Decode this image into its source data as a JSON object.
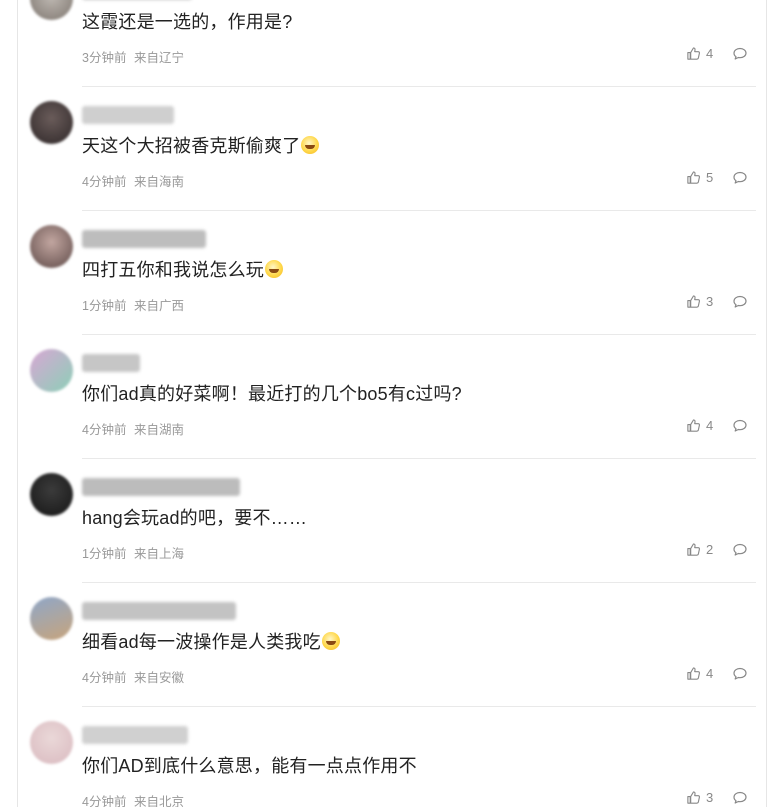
{
  "comments": [
    {
      "text": "这霞还是一选的，作用是?",
      "time": "3分钟前",
      "location": "来自辽宁",
      "likes": "4",
      "emoji": false,
      "avatar_colors": [
        "#bfb9b3",
        "#7d756e"
      ],
      "name_color": "#c9c9c9"
    },
    {
      "text": "天这个大招被香克斯偷爽了",
      "time": "4分钟前",
      "location": "来自海南",
      "likes": "5",
      "emoji": true,
      "avatar_colors": [
        "#6a5c5a",
        "#2e2728"
      ],
      "name_color": "#cfcfcf"
    },
    {
      "text": "四打五你和我说怎么玩",
      "time": "1分钟前",
      "location": "来自广西",
      "likes": "3",
      "emoji": true,
      "avatar_colors": [
        "#c2a6a0",
        "#5e4a48"
      ],
      "name_color": "#bdbdbd"
    },
    {
      "text": "你们ad真的好菜啊！最近打的几个bo5有c过吗?",
      "time": "4分钟前",
      "location": "来自湖南",
      "likes": "4",
      "emoji": false,
      "avatar_colors": [
        "#d8a7d4",
        "#8ccfb7"
      ],
      "name_color": "#c6c6c6"
    },
    {
      "text": "hang会玩ad的吧，要不……",
      "time": "1分钟前",
      "location": "来自上海",
      "likes": "2",
      "emoji": false,
      "avatar_colors": [
        "#3b3b3b",
        "#151515"
      ],
      "name_color": "#bcbcbc"
    },
    {
      "text": "细看ad每一波操作是人类我吃",
      "time": "4分钟前",
      "location": "来自安徽",
      "likes": "4",
      "emoji": true,
      "avatar_colors": [
        "#8fa7c8",
        "#c7a47c"
      ],
      "name_color": "#c3c3c3"
    },
    {
      "text": "你们AD到底什么意思，能有一点点作用不",
      "time": "4分钟前",
      "location": "来自北京",
      "likes": "3",
      "emoji": false,
      "avatar_colors": [
        "#ead8d8",
        "#d9b9bf"
      ],
      "name_color": "#d0d0d0"
    }
  ],
  "icons": {
    "like": "thumbs-up-icon",
    "reply": "comment-bubble-icon"
  }
}
